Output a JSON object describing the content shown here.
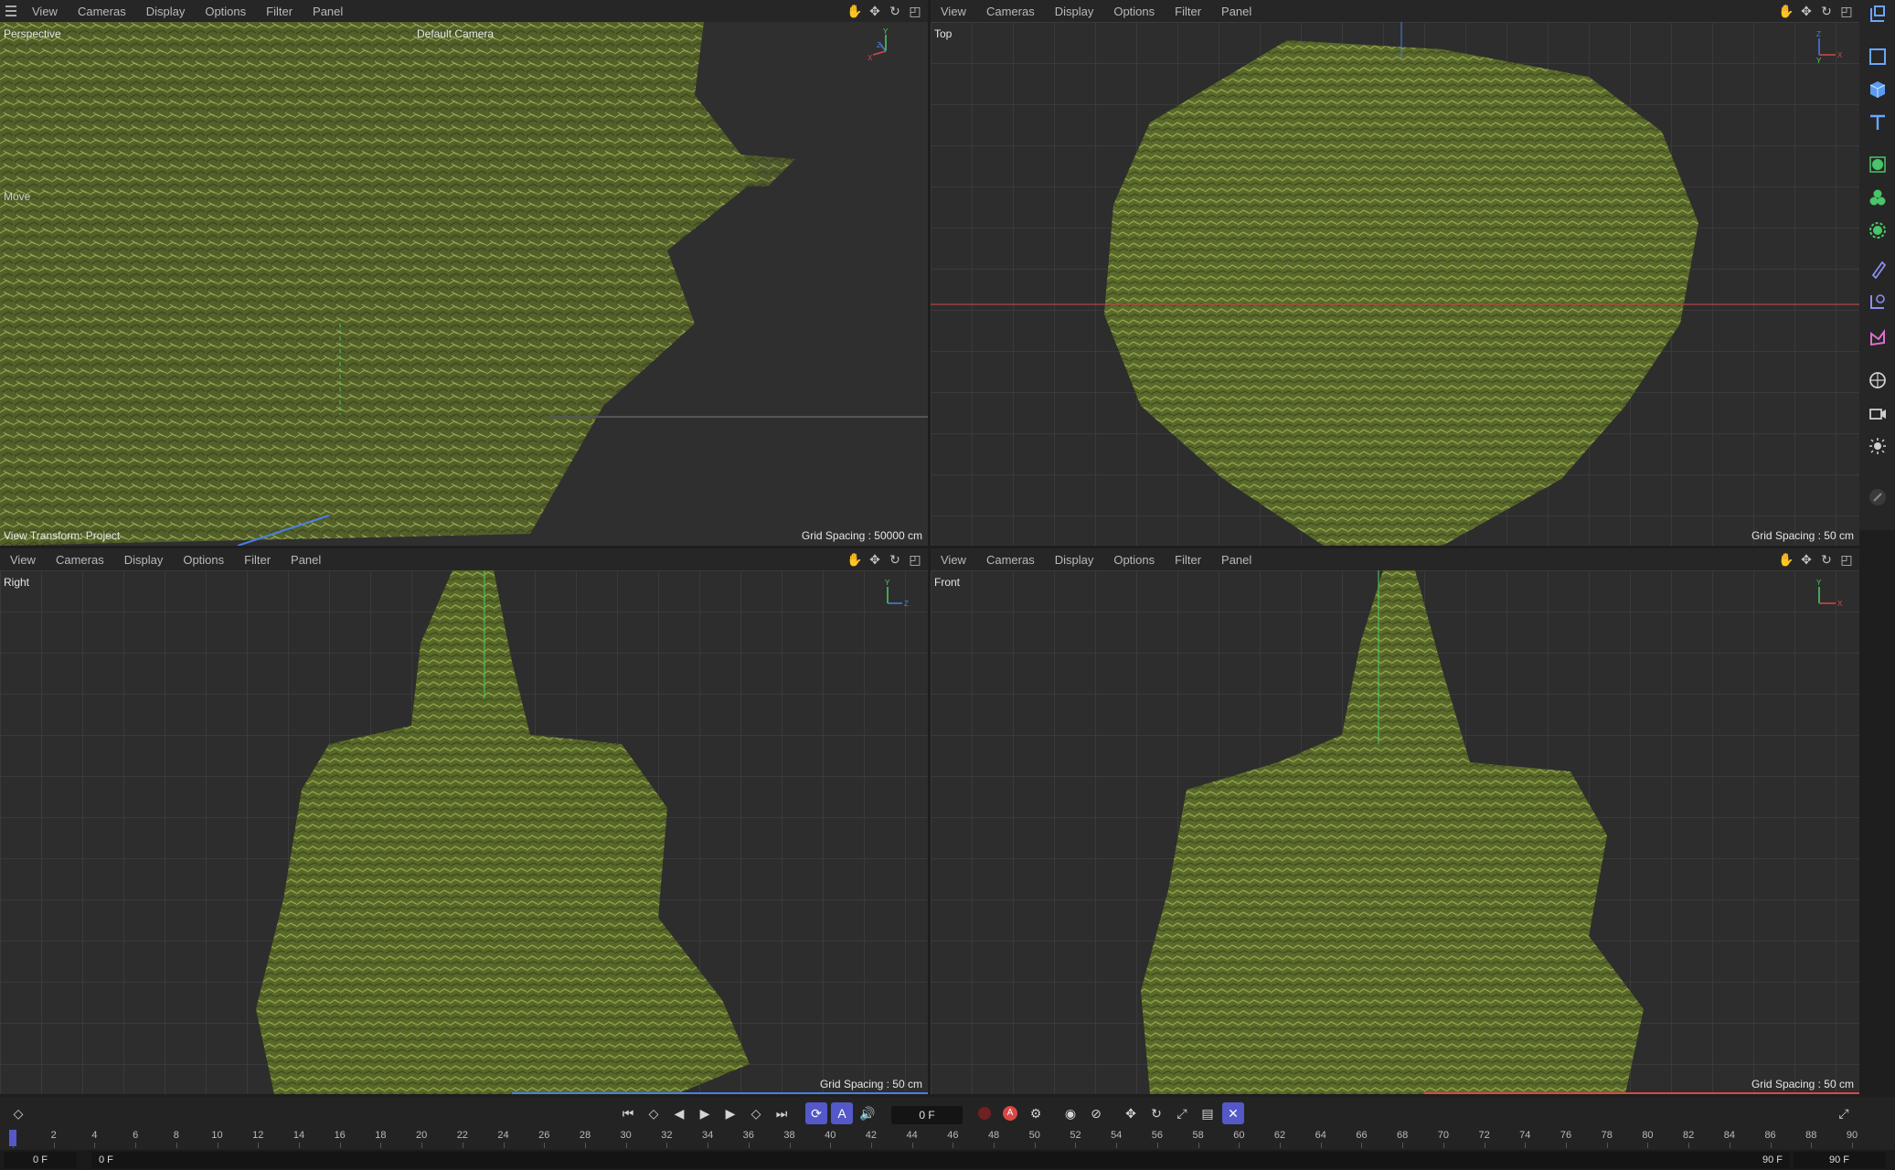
{
  "viewports": {
    "perspective": {
      "menu": [
        "View",
        "Cameras",
        "Display",
        "Options",
        "Filter",
        "Panel"
      ],
      "label": "Perspective",
      "camera": "Default Camera",
      "tool_hint": "Move",
      "view_transform": "View Transform: Project",
      "grid_spacing": "Grid Spacing : 50000 cm"
    },
    "top": {
      "menu": [
        "View",
        "Cameras",
        "Display",
        "Options",
        "Filter",
        "Panel"
      ],
      "label": "Top",
      "grid_spacing": "Grid Spacing : 50 cm"
    },
    "right": {
      "menu": [
        "View",
        "Cameras",
        "Display",
        "Options",
        "Filter",
        "Panel"
      ],
      "label": "Right",
      "grid_spacing": "Grid Spacing : 50 cm"
    },
    "front": {
      "menu": [
        "View",
        "Cameras",
        "Display",
        "Options",
        "Filter",
        "Panel"
      ],
      "label": "Front",
      "grid_spacing": "Grid Spacing : 50 cm"
    }
  },
  "axes": {
    "x": "X",
    "y": "Y",
    "z": "Z"
  },
  "colors": {
    "accent": "#5458c9",
    "viewport_bg": "#2d2d2d",
    "foliage_dark": "#4b5a24",
    "foliage_light": "#8a9a3e",
    "axis_x": "#d84848",
    "axis_y": "#4fcf5f",
    "axis_z": "#4a7fe0"
  },
  "palette_icons": [
    "coordinate-system-icon",
    "cube-outline-icon",
    "cube-icon",
    "text-icon",
    "mograph-cloner-icon",
    "generator-icon",
    "deformer-icon",
    "field-icon",
    "spline-icon",
    "scene-icon",
    "environment-icon",
    "camera-icon",
    "light-icon",
    "brush-icon"
  ],
  "timeline": {
    "current_frame": "0 F",
    "start_frame": "0 F",
    "range_start": "0 F",
    "range_end": "90 F",
    "end_frame": "90 F",
    "ticks": [
      "0",
      "2",
      "4",
      "6",
      "8",
      "10",
      "12",
      "14",
      "16",
      "18",
      "20",
      "22",
      "24",
      "26",
      "28",
      "30",
      "32",
      "34",
      "36",
      "38",
      "40",
      "42",
      "44",
      "46",
      "48",
      "50",
      "52",
      "54",
      "56",
      "58",
      "60",
      "62",
      "64",
      "66",
      "68",
      "70",
      "72",
      "74",
      "76",
      "78",
      "80",
      "82",
      "84",
      "86",
      "88",
      "90"
    ]
  }
}
